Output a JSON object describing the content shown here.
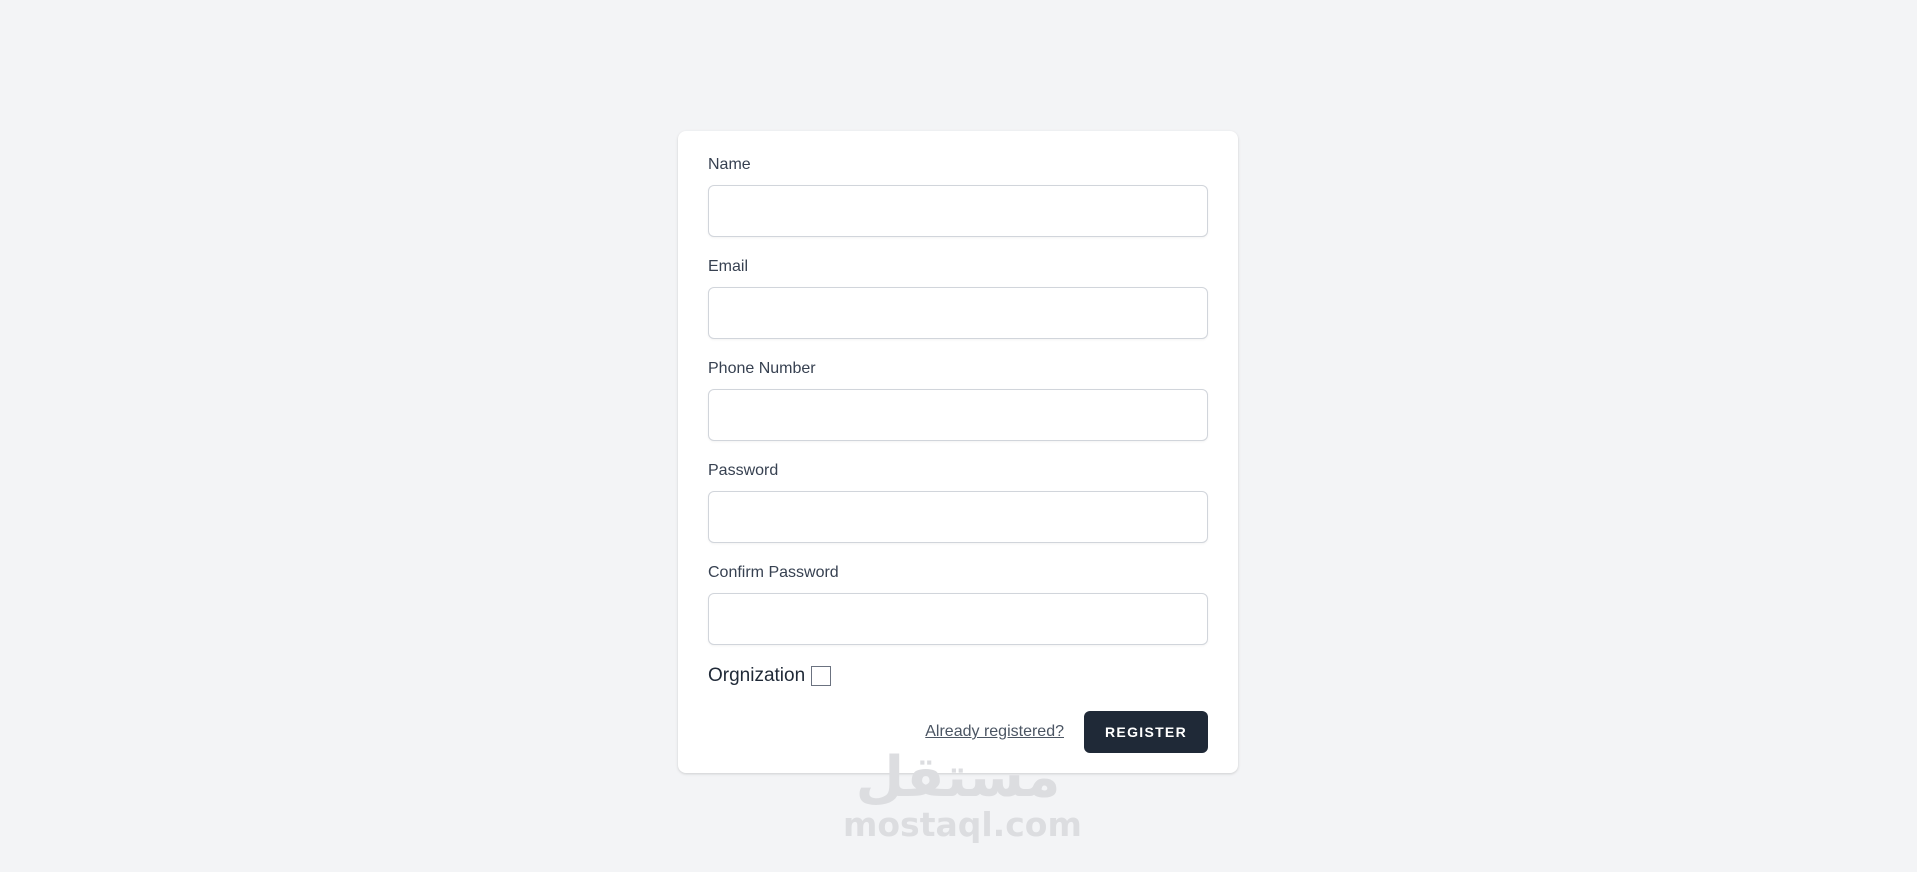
{
  "form": {
    "fields": [
      {
        "label": "Name",
        "value": "",
        "placeholder": ""
      },
      {
        "label": "Email",
        "value": "",
        "placeholder": ""
      },
      {
        "label": "Phone Number",
        "value": "",
        "placeholder": ""
      },
      {
        "label": "Password",
        "value": "",
        "placeholder": ""
      },
      {
        "label": "Confirm Password",
        "value": "",
        "placeholder": ""
      }
    ],
    "organization": {
      "label": "Orgnization",
      "checked": false
    },
    "already_registered_label": "Already registered?",
    "register_label": "REGISTER"
  },
  "watermark": {
    "arabic": "مستقل",
    "latin": "mostaql.com"
  },
  "colors": {
    "background": "#f3f4f6",
    "card": "#ffffff",
    "button": "#1f2937",
    "input_border": "#d1d5db",
    "watermark": "#dcdde0"
  }
}
